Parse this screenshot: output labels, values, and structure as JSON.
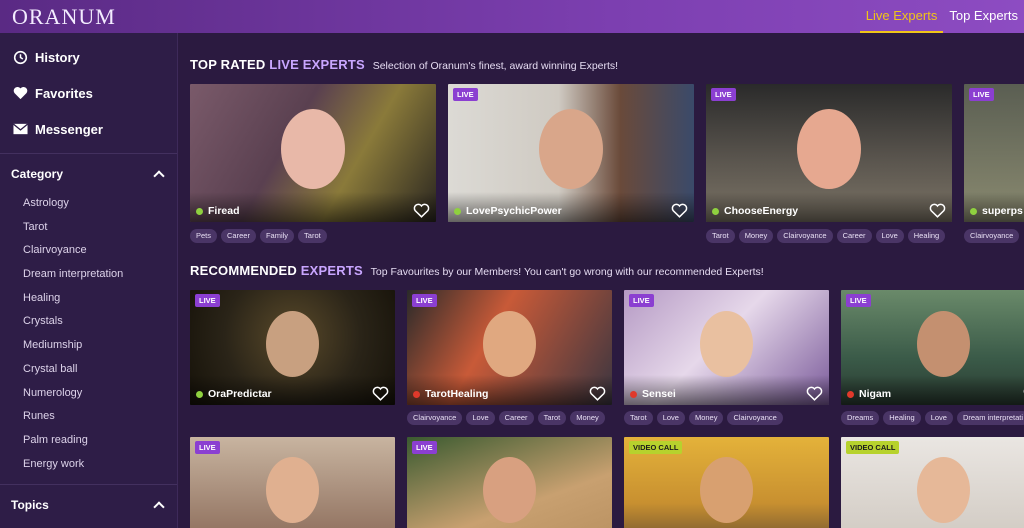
{
  "header": {
    "logo": "ORANUM",
    "tabs": [
      {
        "label": "Live Experts",
        "active": true
      },
      {
        "label": "Top Experts",
        "active": false
      }
    ],
    "accent": "#f0c419"
  },
  "sidebar": {
    "links": [
      {
        "label": "History",
        "icon": "history-icon"
      },
      {
        "label": "Favorites",
        "icon": "heart-icon"
      },
      {
        "label": "Messenger",
        "icon": "envelope-icon"
      }
    ],
    "category": {
      "title": "Category",
      "items": [
        "Astrology",
        "Tarot",
        "Clairvoyance",
        "Dream interpretation",
        "Healing",
        "Crystals",
        "Mediumship",
        "Crystal ball",
        "Numerology",
        "Runes",
        "Palm reading",
        "Energy work"
      ]
    },
    "topics": {
      "title": "Topics"
    }
  },
  "top_rated": {
    "title_a": "TOP RATED ",
    "title_b": "LIVE EXPERTS",
    "subtitle": "Selection of Oranum's finest, award winning Experts!",
    "cards": [
      {
        "name": "Firead",
        "badge": "",
        "status": "online",
        "tags": [
          "Pets",
          "Career",
          "Family",
          "Tarot"
        ]
      },
      {
        "name": "LovePsychicPower",
        "badge": "LIVE",
        "status": "online",
        "tags": []
      },
      {
        "name": "ChooseEnergy",
        "badge": "LIVE",
        "status": "online",
        "tags": [
          "Tarot",
          "Money",
          "Clairvoyance",
          "Career",
          "Love",
          "Healing"
        ]
      },
      {
        "name": "superps",
        "badge": "LIVE",
        "status": "online",
        "tags": [
          "Clairvoyance"
        ]
      }
    ]
  },
  "recommended": {
    "title_a": "RECOMMENDED ",
    "title_b": "EXPERTS",
    "subtitle": "Top Favourites by our Members! You can't go wrong with our recommended Experts!",
    "cards": [
      {
        "name": "OraPredictar",
        "badge": "LIVE",
        "status": "online",
        "tags": []
      },
      {
        "name": "TarotHealing",
        "badge": "LIVE",
        "status": "busy",
        "tags": [
          "Clairvoyance",
          "Love",
          "Career",
          "Tarot",
          "Money"
        ]
      },
      {
        "name": "Sensei",
        "badge": "LIVE",
        "status": "busy",
        "tags": [
          "Tarot",
          "Love",
          "Money",
          "Clairvoyance"
        ]
      },
      {
        "name": "Nigam",
        "badge": "LIVE",
        "status": "busy",
        "tags": [
          "Dreams",
          "Healing",
          "Love",
          "Dream interpretati"
        ]
      }
    ],
    "row2_badges": [
      "LIVE",
      "LIVE",
      "VIDEO CALL",
      "VIDEO CALL"
    ]
  },
  "status_colors": {
    "online": "#8fd13f",
    "busy": "#e0392b"
  }
}
